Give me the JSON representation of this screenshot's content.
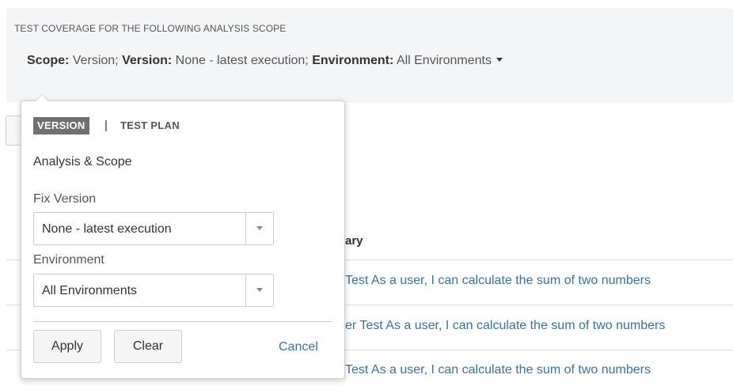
{
  "scope": {
    "heading": "TEST COVERAGE FOR THE FOLLOWING ANALYSIS SCOPE",
    "scope_label": "Scope:",
    "scope_value": "Version;",
    "version_label": "Version:",
    "version_value": "None - latest execution;",
    "environment_label": "Environment:",
    "environment_value": "All Environments"
  },
  "table": {
    "header_partial": "ary",
    "rows": [
      {
        "summary_partial": "Test As a user, I can calculate the sum of two numbers"
      },
      {
        "summary_partial": "er Test As a user, I can calculate the sum of two numbers"
      },
      {
        "summary_partial": "Test As a user, I can calculate the sum of two numbers"
      }
    ]
  },
  "popover": {
    "tabs": [
      {
        "label": "VERSION",
        "active": true
      },
      {
        "label": "TEST PLAN",
        "active": false
      }
    ],
    "tab_separator": "|",
    "section_title": "Analysis & Scope",
    "fix_version": {
      "label": "Fix Version",
      "value": "None - latest execution"
    },
    "environment": {
      "label": "Environment",
      "value": "All Environments"
    },
    "apply_label": "Apply",
    "clear_label": "Clear",
    "cancel_label": "Cancel"
  },
  "colors": {
    "link": "#3572b0",
    "panel_bg": "#f4f5f7",
    "active_tab_bg": "#707070"
  }
}
